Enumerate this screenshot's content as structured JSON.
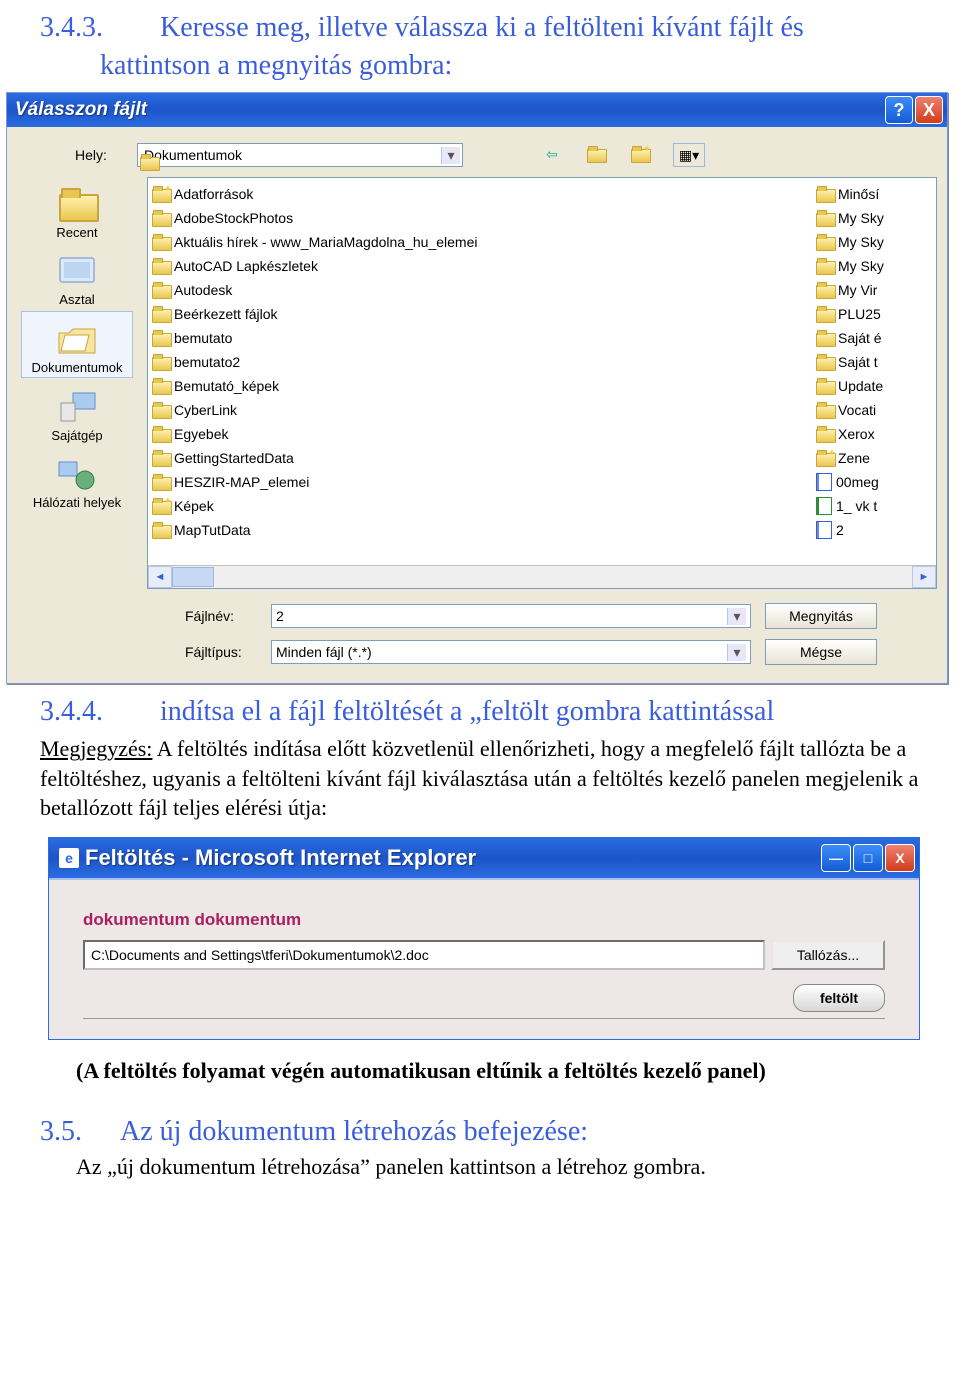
{
  "doc": {
    "step343_num": "3.4.3.",
    "step343_line1": "Keresse meg, illetve válassza ki a feltölteni kívánt fájlt és",
    "step343_line2": "kattintson a megnyitás gombra:",
    "step344_num": "3.4.4.",
    "step344_text": "indítsa el a fájl feltöltését a „feltölt gombra kattintással",
    "note_label": "Megjegyzés:",
    "note_body": " A feltöltés indítása előtt közvetlenül ellenőrizheti, hogy a megfelelő fájlt tallózta be a feltöltéshez, ugyanis a feltölteni kívánt fájl kiválasztása után a feltöltés kezelő panelen megjelenik a betallózott fájl teljes elérési útja:",
    "after_ie": "(A feltöltés folyamat végén automatikusan eltűnik a feltöltés kezelő panel)",
    "step35_num": "3.5.",
    "step35_text": "Az új dokumentum létrehozás befejezése:",
    "step35_sub": "Az „új dokumentum létrehozása” panelen kattintson a létrehoz gombra."
  },
  "dialog": {
    "title": "Válasszon fájlt",
    "help": "?",
    "close": "X",
    "look_label": "Hely:",
    "look_value": "Dokumentumok",
    "places": [
      {
        "label": "Recent",
        "icon": "recent"
      },
      {
        "label": "Asztal",
        "icon": "desktop"
      },
      {
        "label": "Dokumentumok",
        "icon": "mydocs",
        "selected": true
      },
      {
        "label": "Sajátgép",
        "icon": "computer"
      },
      {
        "label": "Hálózati helyek",
        "icon": "network"
      }
    ],
    "files_col1": [
      {
        "n": "Adatforrások",
        "t": "folder-sp"
      },
      {
        "n": "AdobeStockPhotos",
        "t": "folder"
      },
      {
        "n": "Aktuális hírek - www_MariaMagdolna_hu_elemei",
        "t": "folder"
      },
      {
        "n": "AutoCAD Lapkészletek",
        "t": "folder"
      },
      {
        "n": "Autodesk",
        "t": "folder"
      },
      {
        "n": "Beérkezett fájlok",
        "t": "folder"
      },
      {
        "n": "bemutato",
        "t": "folder"
      },
      {
        "n": "bemutato2",
        "t": "folder"
      },
      {
        "n": "Bemutató_képek",
        "t": "folder"
      },
      {
        "n": "CyberLink",
        "t": "folder"
      },
      {
        "n": "Egyebek",
        "t": "folder"
      },
      {
        "n": "GettingStartedData",
        "t": "folder"
      },
      {
        "n": "HESZIR-MAP_elemei",
        "t": "folder"
      },
      {
        "n": "Képek",
        "t": "folder-sp"
      },
      {
        "n": "MapTutData",
        "t": "folder"
      }
    ],
    "files_col2": [
      {
        "n": "Minősí",
        "t": "folder"
      },
      {
        "n": "My Sky",
        "t": "folder"
      },
      {
        "n": "My Sky",
        "t": "folder"
      },
      {
        "n": "My Sky",
        "t": "folder"
      },
      {
        "n": "My Vir",
        "t": "folder"
      },
      {
        "n": "PLU25",
        "t": "folder"
      },
      {
        "n": "Saját é",
        "t": "folder"
      },
      {
        "n": "Saját t",
        "t": "folder"
      },
      {
        "n": "Update",
        "t": "folder"
      },
      {
        "n": "Vocati",
        "t": "folder"
      },
      {
        "n": "Xerox",
        "t": "folder"
      },
      {
        "n": "Zene",
        "t": "folder-sp"
      },
      {
        "n": "00meg",
        "t": "doc"
      },
      {
        "n": "1_ vk t",
        "t": "xls"
      },
      {
        "n": "2",
        "t": "doc"
      }
    ],
    "filename_label": "Fájlnév:",
    "filename_value": "2",
    "filetype_label": "Fájltípus:",
    "filetype_value": "Minden fájl (*.*)",
    "open_btn": "Megnyitás",
    "cancel_btn": "Mégse"
  },
  "ie": {
    "title": "Feltöltés - Microsoft Internet Explorer",
    "panel_title": "dokumentum dokumentum",
    "path": "C:\\Documents and Settings\\tferi\\Dokumentumok\\2.doc",
    "browse": "Tallózás...",
    "upload": "feltölt",
    "min": "—",
    "max": "□",
    "close": "X"
  }
}
